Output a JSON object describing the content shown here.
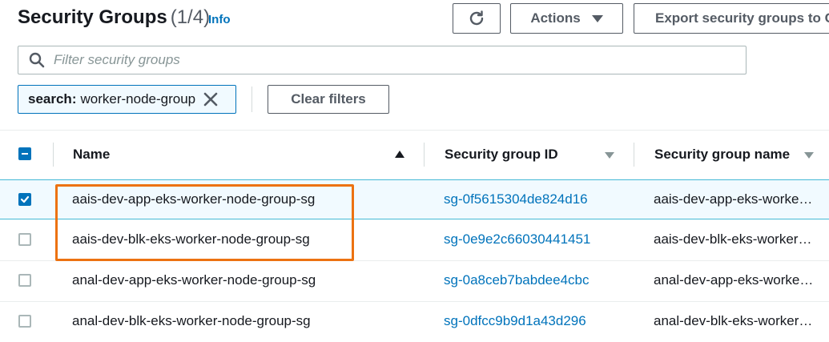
{
  "header": {
    "title": "Security Groups",
    "count": "(1/4)",
    "info_link": "Info",
    "refresh_icon": "refresh-icon",
    "actions_label": "Actions",
    "export_label": "Export security groups to CSV"
  },
  "search": {
    "placeholder": "Filter security groups",
    "icon": "search-icon"
  },
  "filter_token": {
    "key": "search:",
    "value": "worker-node-group"
  },
  "clear_filters_label": "Clear filters",
  "table": {
    "columns": [
      {
        "label": "Name",
        "sort": "ascending"
      },
      {
        "label": "Security group ID",
        "sort": "none"
      },
      {
        "label": "Security group name",
        "sort": "none"
      }
    ],
    "rows": [
      {
        "checked": true,
        "name": "aais-dev-app-eks-worker-node-group-sg",
        "group_id": "sg-0f5615304de824d16",
        "group_name": "aais-dev-app-eks-worker-node-group-sg"
      },
      {
        "checked": false,
        "name": "aais-dev-blk-eks-worker-node-group-sg",
        "group_id": "sg-0e9e2c66030441451",
        "group_name": "aais-dev-blk-eks-worker-node-group-sg"
      },
      {
        "checked": false,
        "name": "anal-dev-app-eks-worker-node-group-sg",
        "group_id": "sg-0a8ceb7babdee4cbc",
        "group_name": "anal-dev-app-eks-worker-node-group-sg"
      },
      {
        "checked": false,
        "name": "anal-dev-blk-eks-worker-node-group-sg",
        "group_id": "sg-0dfcc9b9d1a43d296",
        "group_name": "anal-dev-blk-eks-worker-node-group-sg"
      }
    ]
  },
  "colors": {
    "link": "#0073bb",
    "selected_bg": "#f1faff",
    "highlight": "#ec7211"
  }
}
